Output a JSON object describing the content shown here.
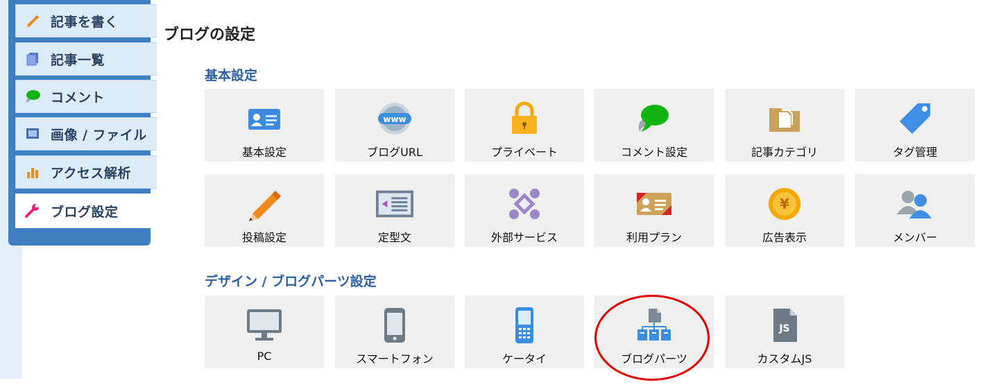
{
  "sidebar": {
    "items": [
      {
        "label": "記事を書く",
        "icon": "pencil-icon"
      },
      {
        "label": "記事一覧",
        "icon": "documents-icon"
      },
      {
        "label": "コメント",
        "icon": "speech-bubble-icon"
      },
      {
        "label": "画像 / ファイル",
        "icon": "image-frame-icon"
      },
      {
        "label": "アクセス解析",
        "icon": "bar-chart-icon"
      },
      {
        "label": "ブログ設定",
        "icon": "wrench-icon"
      }
    ],
    "active": "ブログ設定"
  },
  "page": {
    "title": "ブログの設定"
  },
  "basic_settings": {
    "title": "基本設定",
    "tiles": [
      {
        "label": "基本設定",
        "icon": "id-card-icon"
      },
      {
        "label": "ブログURL",
        "icon": "www-globe-icon"
      },
      {
        "label": "プライベート",
        "icon": "padlock-icon"
      },
      {
        "label": "コメント設定",
        "icon": "speech-bubbles-icon"
      },
      {
        "label": "記事カテゴリ",
        "icon": "folder-documents-icon"
      },
      {
        "label": "タグ管理",
        "icon": "tag-icon"
      },
      {
        "label": "投稿設定",
        "icon": "pencil-icon"
      },
      {
        "label": "定型文",
        "icon": "text-template-icon"
      },
      {
        "label": "外部サービス",
        "icon": "puzzle-icon"
      },
      {
        "label": "利用プラン",
        "icon": "plan-card-icon"
      },
      {
        "label": "広告表示",
        "icon": "yen-coin-icon"
      },
      {
        "label": "メンバー",
        "icon": "members-icon"
      }
    ]
  },
  "design_settings": {
    "title": "デザイン / ブログパーツ設定",
    "tiles": [
      {
        "label": "PC",
        "icon": "monitor-icon"
      },
      {
        "label": "スマートフォン",
        "icon": "smartphone-icon"
      },
      {
        "label": "ケータイ",
        "icon": "feature-phone-icon"
      },
      {
        "label": "ブログパーツ",
        "icon": "blog-parts-icon"
      },
      {
        "label": "カスタムJS",
        "icon": "js-file-icon"
      }
    ]
  },
  "colors": {
    "sidebar": "#3e7fc1",
    "section_title": "#2c5ea2",
    "tile_bg": "#efefef",
    "highlight": "#e30000"
  }
}
